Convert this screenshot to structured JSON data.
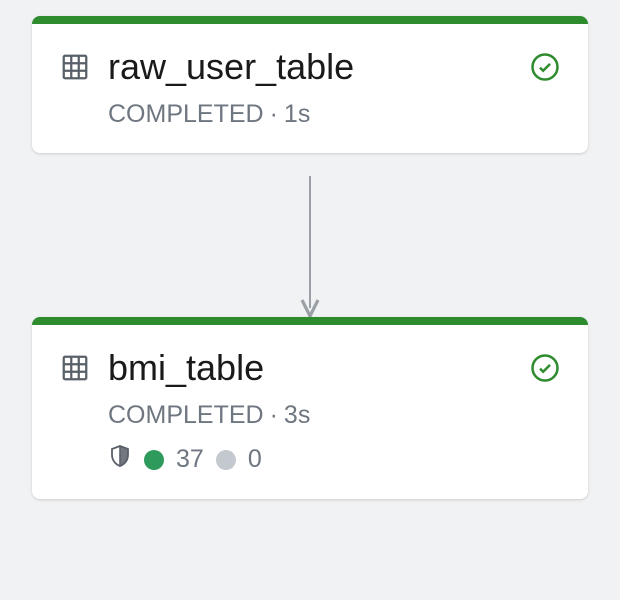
{
  "colors": {
    "accent_bar": "#2e8b2e",
    "success_icon": "#2e8b2e",
    "metric_pass": "#2e9a5c",
    "metric_none": "#c4c9cf",
    "text_muted": "#6e7680"
  },
  "nodes": [
    {
      "id": "raw_user_table",
      "title": "raw_user_table",
      "status_label": "COMPLETED",
      "separator": "·",
      "duration": "1s",
      "has_metrics": false
    },
    {
      "id": "bmi_table",
      "title": "bmi_table",
      "status_label": "COMPLETED",
      "separator": "·",
      "duration": "3s",
      "has_metrics": true,
      "metrics": {
        "pass_count": "37",
        "fail_count": "0"
      }
    }
  ],
  "edges": [
    {
      "from": "raw_user_table",
      "to": "bmi_table"
    }
  ]
}
